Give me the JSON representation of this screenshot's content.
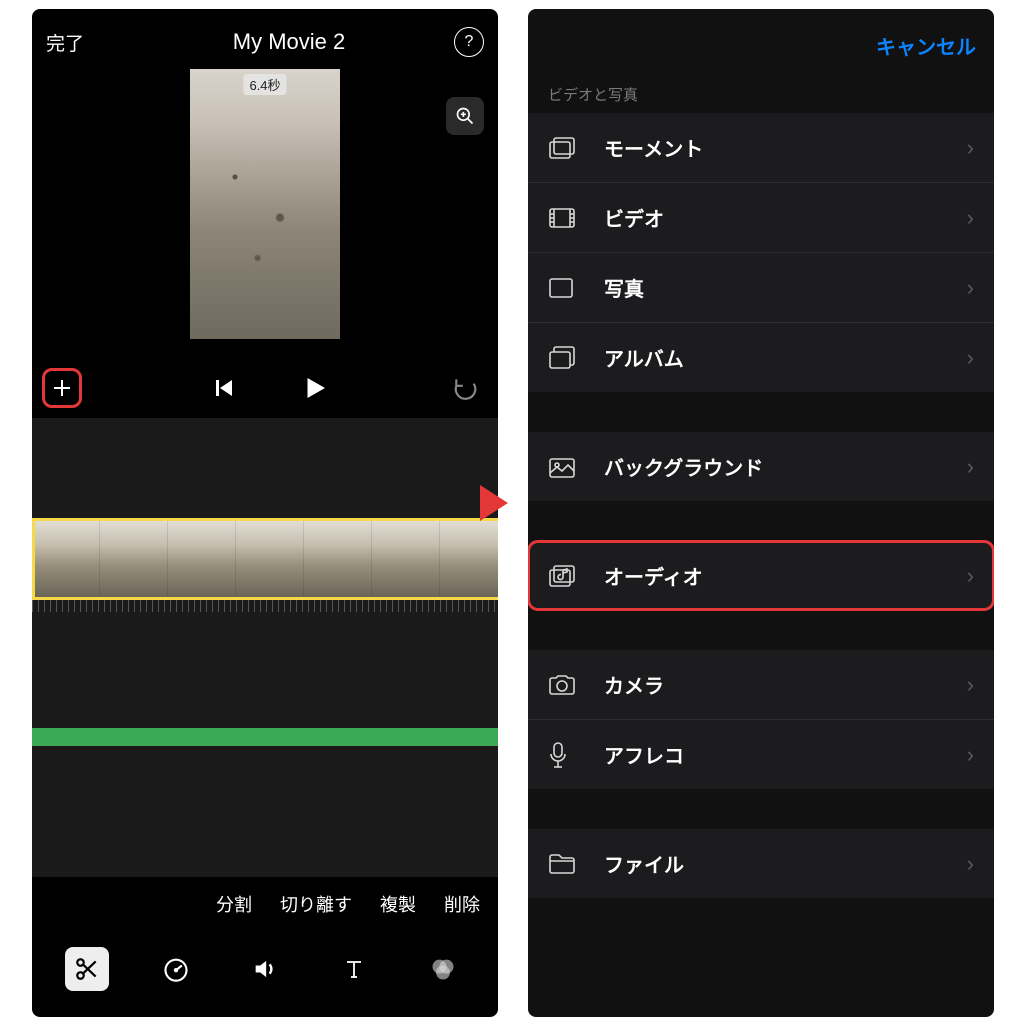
{
  "left": {
    "done_label": "完了",
    "title": "My Movie 2",
    "duration_tag": "6.4秒",
    "actions": {
      "split": "分割",
      "detach": "切り離す",
      "duplicate": "複製",
      "delete": "削除"
    }
  },
  "right": {
    "cancel_label": "キャンセル",
    "section_label": "ビデオと写真",
    "group1": [
      {
        "label": "モーメント",
        "icon": "moments"
      },
      {
        "label": "ビデオ",
        "icon": "video"
      },
      {
        "label": "写真",
        "icon": "photo"
      },
      {
        "label": "アルバム",
        "icon": "album"
      }
    ],
    "group2": [
      {
        "label": "バックグラウンド",
        "icon": "background"
      }
    ],
    "group3": [
      {
        "label": "オーディオ",
        "icon": "audio",
        "highlighted": true
      }
    ],
    "group4": [
      {
        "label": "カメラ",
        "icon": "camera"
      },
      {
        "label": "アフレコ",
        "icon": "mic"
      }
    ],
    "group5": [
      {
        "label": "ファイル",
        "icon": "folder"
      }
    ]
  }
}
